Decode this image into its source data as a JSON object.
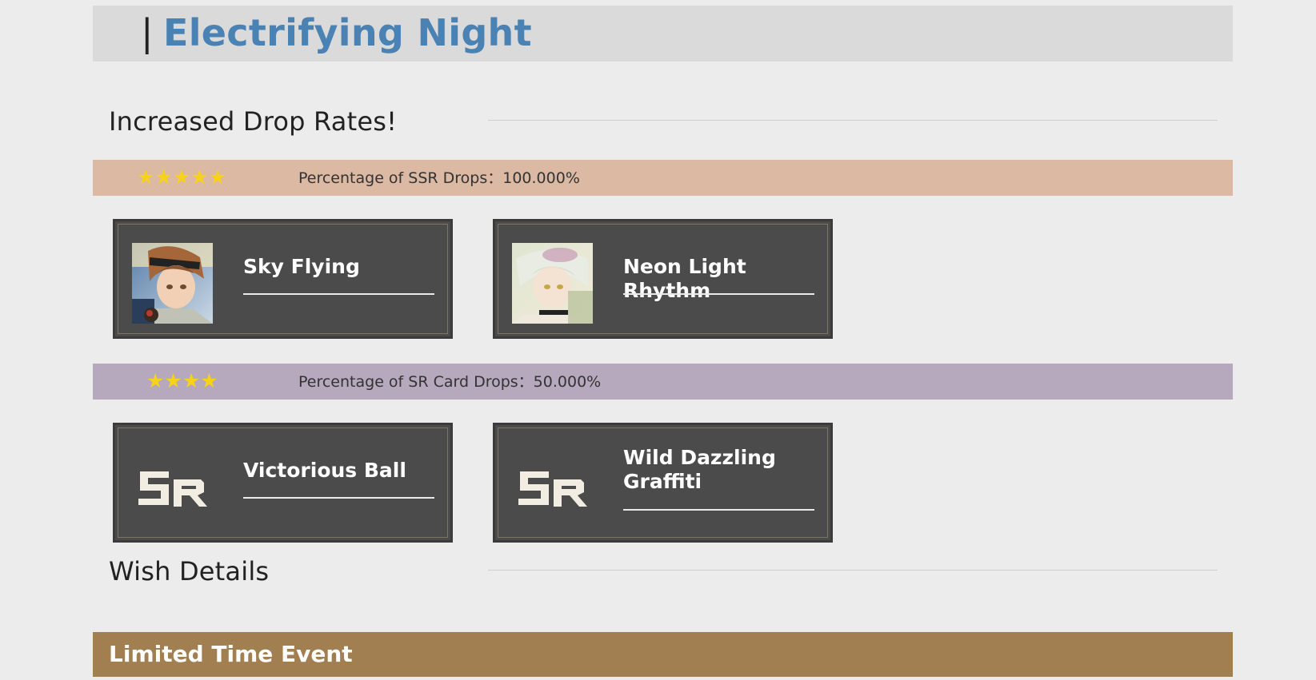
{
  "header": {
    "separator": "|",
    "title": "Electrifying Night"
  },
  "drop_rates": {
    "heading": "Increased Drop Rates!",
    "ssr": {
      "stars": "★★★★★",
      "rate_text": "Percentage of SSR Drops：100.000%",
      "cards": [
        {
          "name": "Sky Flying",
          "image": "character-portrait-brown-hair"
        },
        {
          "name": "Neon Light Rhythm",
          "image": "character-portrait-white-hair"
        }
      ]
    },
    "sr": {
      "stars": "★★★★",
      "rate_text": "Percentage of SR Card Drops：50.000%",
      "cards": [
        {
          "name": "Victorious Ball",
          "image": "sr-logo"
        },
        {
          "name": "Wild Dazzling Graffiti",
          "image": "sr-logo"
        }
      ]
    }
  },
  "wish_details": {
    "heading": "Wish Details"
  },
  "event": {
    "label": "Limited Time Event"
  },
  "colors": {
    "title_blue": "#4a82b4",
    "ssr_bar": "#dbb9a3",
    "sr_bar": "#b6a9bd",
    "card_bg": "#4b4b4b",
    "event_bar": "#a27f50",
    "star_gold": "#f7d21a"
  }
}
